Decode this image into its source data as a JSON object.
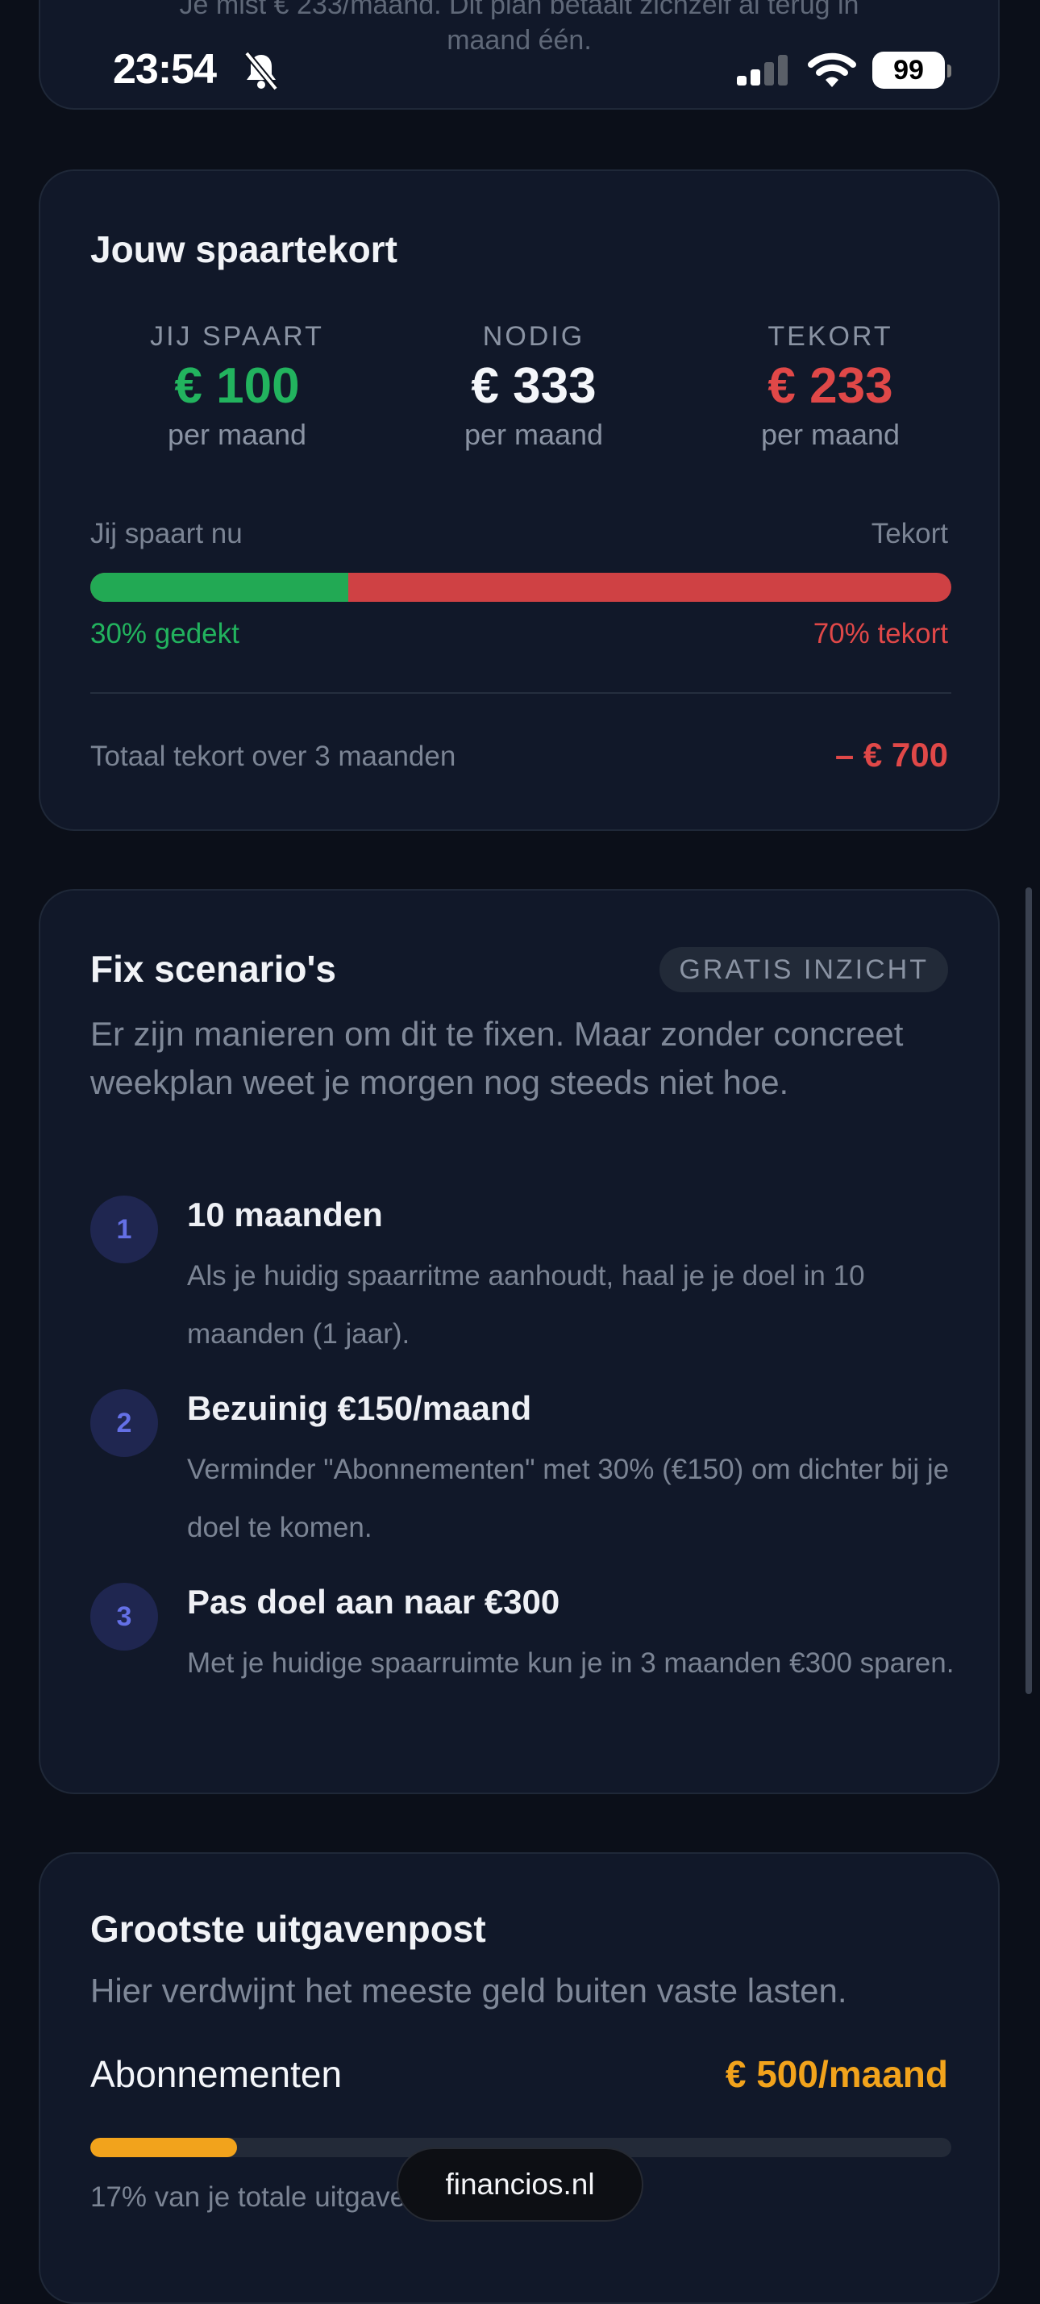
{
  "top_card": {
    "line1": "Je mist € 233/maand. Dit plan betaalt zichzelf al terug in",
    "line2": "maand één."
  },
  "status_bar": {
    "time": "23:54",
    "battery": "99"
  },
  "shortfall": {
    "title": "Jouw spaartekort",
    "columns": [
      {
        "label": "JIJ SPAART",
        "value": "€ 100",
        "sub": "per maand",
        "color": "#22b35e"
      },
      {
        "label": "NODIG",
        "value": "€ 333",
        "sub": "per maand",
        "color": "#f4f6fa"
      },
      {
        "label": "TEKORT",
        "value": "€ 233",
        "sub": "per maand",
        "color": "#e04848"
      }
    ],
    "bar_left_label": "Jij spaart nu",
    "bar_right_label": "Tekort",
    "covered_fraction": 0.3,
    "covered_text": "30% gedekt",
    "shortfall_text": "70% tekort",
    "total_label": "Totaal tekort over 3 maanden",
    "total_value": "– € 700"
  },
  "scenarios": {
    "title": "Fix scenario's",
    "badge": "GRATIS INZICHT",
    "lead": "Er zijn manieren om dit te fixen. Maar zonder concreet weekplan weet je morgen nog steeds niet hoe.",
    "items": [
      {
        "num": "1",
        "title": "10 maanden",
        "desc": "Als je huidig spaarritme aanhoudt, haal je je doel in 10 maanden (1 jaar)."
      },
      {
        "num": "2",
        "title": "Bezuinig €150/maand",
        "desc": "Verminder \"Abonnementen\" met 30% (€150) om dichter bij je doel te komen."
      },
      {
        "num": "3",
        "title": "Pas doel aan naar €300",
        "desc": "Met je huidige spaarruimte kun je in 3 maanden €300 sparen."
      }
    ]
  },
  "expense": {
    "title": "Grootste uitgavenpost",
    "lead": "Hier verdwijnt het meeste geld buiten vaste lasten.",
    "category": "Abonnementen",
    "amount": "€ 500/maand",
    "share_fraction": 0.17,
    "share_text": "17% van je totale uitgaven"
  },
  "site_pill": "financios.nl",
  "colors": {
    "green": "#22b35e",
    "red": "#e04848",
    "orange": "#f2a31c",
    "accent": "#6470e6"
  },
  "icons": [
    "bell-slash-icon",
    "signal-icon",
    "wifi-icon",
    "battery-icon"
  ]
}
